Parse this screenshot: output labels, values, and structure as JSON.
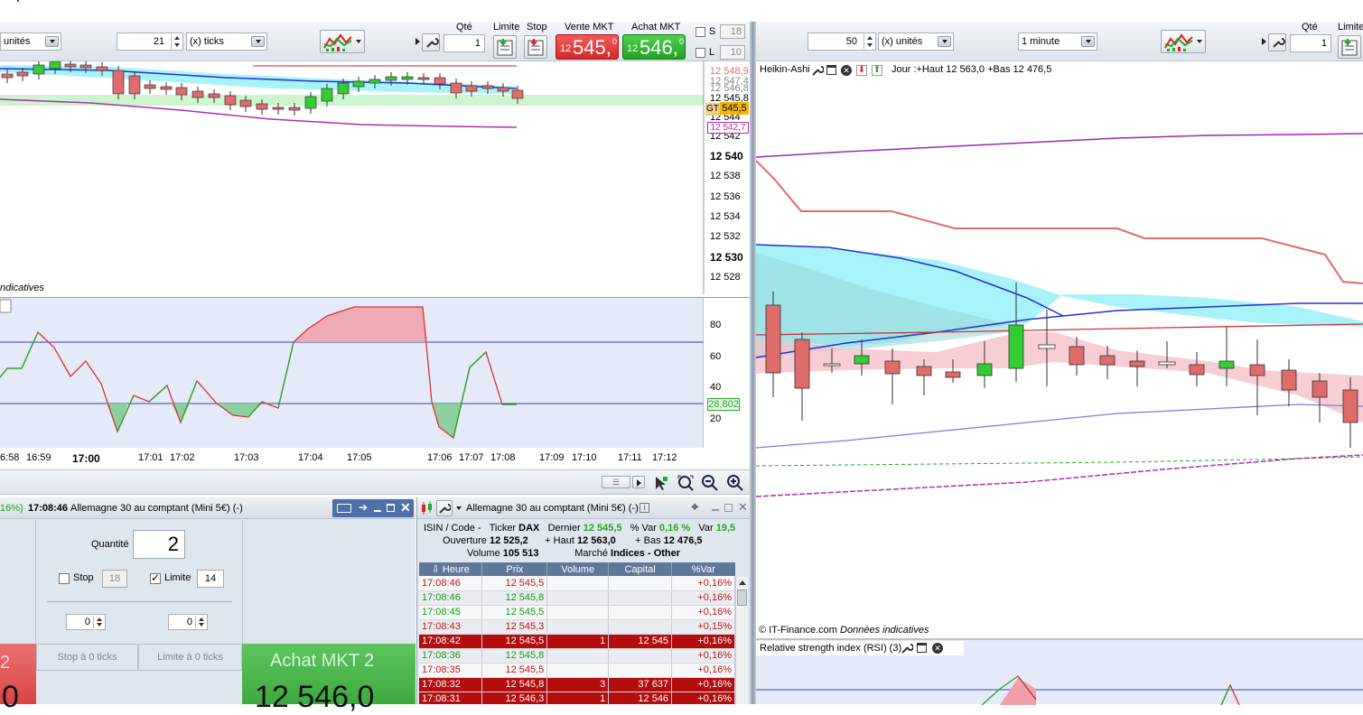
{
  "left_toolbar": {
    "units_select": "unités",
    "ticks_value": "21",
    "ticks_select": "(x) ticks",
    "qty_label": "Qté",
    "qty_value": "1",
    "limit_label": "Limite",
    "stop_label": "Stop",
    "sell_label": "Vente MKT",
    "sell_prefix": "12",
    "sell_price": "545,",
    "sell_decimal": "0",
    "buy_label": "Achat MKT",
    "buy_prefix": "12",
    "buy_price": "546,",
    "buy_decimal": "0",
    "s_label": "S",
    "s_value": "18",
    "l_label": "L",
    "l_value": "10"
  },
  "right_toolbar": {
    "units_value": "50",
    "units_select": "(x) unités",
    "interval_select": "1 minute",
    "qty_label": "Qté",
    "qty_value": "1",
    "limit_label": "Limite"
  },
  "left_chart": {
    "price_labels": [
      "12 548,9",
      "12 547,4",
      "12 546,8",
      "12 545,8",
      "12 544",
      "12 542",
      "12 540",
      "12 538",
      "12 536",
      "12 534",
      "12 532",
      "12 530",
      "12 528"
    ],
    "badge_gt": "GT",
    "badge_price": "545,5",
    "badge_low": "12 542,7",
    "footer_text": "ndicatives"
  },
  "rsi_left": {
    "axis_labels": [
      "80",
      "60",
      "40",
      "20"
    ],
    "value_badge": "28,802"
  },
  "time_axis": [
    "6:58",
    "16:59",
    "17:00",
    "17:01",
    "17:02",
    "17:03",
    "17:04",
    "17:05",
    "17:06",
    "17:07",
    "17:08",
    "17:09",
    "17:10",
    "17:11",
    "17:12"
  ],
  "order_panel": {
    "header_pct": "16%)",
    "header_time": "17:08:46",
    "header_title": "Allemagne 30 au comptant (Mini 5€) (-)",
    "qty_label": "Quantité",
    "qty_value": "2",
    "stop_label": "Stop",
    "stop_value": "18",
    "limit_label": "Limite",
    "limit_value": "14",
    "offset_left": "0",
    "offset_right": "0",
    "stop_ticks": "Stop à 0 ticks",
    "limit_ticks": "Limite à 0 ticks",
    "sell_partial": "2",
    "sell_price_partial": "0",
    "buy_label": "Achat MKT 2",
    "buy_price": "12 546,0"
  },
  "quote_panel": {
    "title": "Allemagne 30 au comptant (Mini 5€) (-)",
    "isin_label": "ISIN / Code -",
    "ticker_label": "Ticker",
    "ticker": "DAX",
    "last_label": "Dernier",
    "last": "12 545,5",
    "pctvar_label": "% Var",
    "pctvar": "0,16 %",
    "var_label": "Var",
    "var": "19,5",
    "open_label": "Ouverture",
    "open": "12 525,2",
    "high_label": "+ Haut",
    "high": "12 563,0",
    "low_label": "+ Bas",
    "low": "12 476,5",
    "volume_label": "Volume",
    "volume": "105 513",
    "market_label": "Marché",
    "market": "Indices - Other",
    "columns": [
      "Heure",
      "Prix",
      "Volume",
      "Capital",
      "%Var"
    ],
    "rows": [
      {
        "time": "17:08:46",
        "price": "12 545,5",
        "volume": "",
        "capital": "",
        "var": "+0,16%",
        "style": "red"
      },
      {
        "time": "17:08:46",
        "price": "12 545,8",
        "volume": "",
        "capital": "",
        "var": "+0,16%",
        "style": "green"
      },
      {
        "time": "17:08:45",
        "price": "12 545,5",
        "volume": "",
        "capital": "",
        "var": "+0,16%",
        "style": "green"
      },
      {
        "time": "17:08:43",
        "price": "12 545,3",
        "volume": "",
        "capital": "",
        "var": "+0,15%",
        "style": "red"
      },
      {
        "time": "17:08:42",
        "price": "12 545,5",
        "volume": "1",
        "capital": "12 545",
        "var": "+0,16%",
        "style": "hl"
      },
      {
        "time": "17:08:36",
        "price": "12 545,8",
        "volume": "",
        "capital": "",
        "var": "+0,16%",
        "style": "green"
      },
      {
        "time": "17:08:35",
        "price": "12 545,5",
        "volume": "",
        "capital": "",
        "var": "+0,16%",
        "style": "red"
      },
      {
        "time": "17:08:32",
        "price": "12 545,8",
        "volume": "3",
        "capital": "37 637",
        "var": "+0,16%",
        "style": "hl"
      },
      {
        "time": "17:08:31",
        "price": "12 546,3",
        "volume": "1",
        "capital": "12 546",
        "var": "+0,16%",
        "style": "hl"
      }
    ]
  },
  "right_chart": {
    "title": "Heikin-Ashi",
    "day_info": "Jour :+Haut 12 563,0 +Bas 12 476,5",
    "copyright": "© IT-Finance.com",
    "copyright_note": "Données indicatives",
    "rsi_title": "Relative strength index (RSI) (3)"
  },
  "colors": {
    "up": "#33cc33",
    "down": "#e06b6b",
    "sell": "#e83a3a",
    "buy": "#2fb52f",
    "cyan": "#a8f3f9",
    "panel": "#dfe7ee"
  }
}
